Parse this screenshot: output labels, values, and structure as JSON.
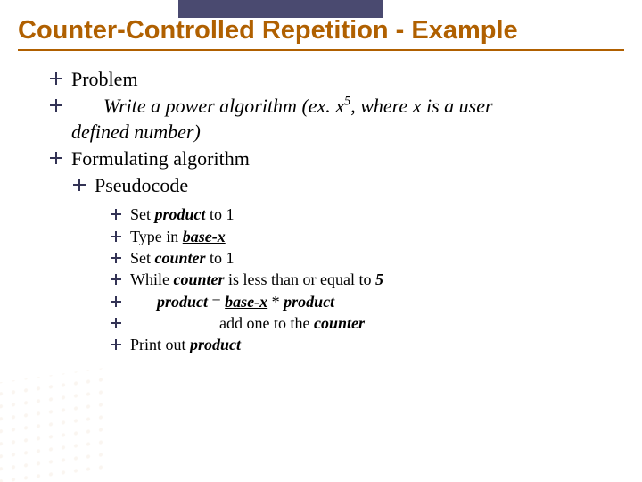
{
  "title": "Counter-Controlled Repetition - Example",
  "b1": "Problem",
  "b2_lead": "Write a power algorithm (ex. ",
  "b2_x": "x",
  "b2_sup": "5",
  "b2_mid": ", where ",
  "b2_x2": "x",
  "b2_tail": " is a user",
  "b2_cont": "defined number)",
  "b3": "Formulating algorithm",
  "b4": "Pseudocode",
  "p1a": "Set ",
  "p1b": "product",
  "p1c": " to 1",
  "p2a": "Type in ",
  "p2b": "base-x",
  "p3a": "Set ",
  "p3b": "counter",
  "p3c": " to 1",
  "p4a": "While ",
  "p4b": "counter",
  "p4c": " is less than or equal to ",
  "p4d": "5",
  "p5a": "product",
  "p5b": " = ",
  "p5c": "base-x",
  "p5d": " * ",
  "p5e": "product",
  "p6a": "add one to the ",
  "p6b": "counter",
  "p7a": "Print out ",
  "p7b": "product"
}
